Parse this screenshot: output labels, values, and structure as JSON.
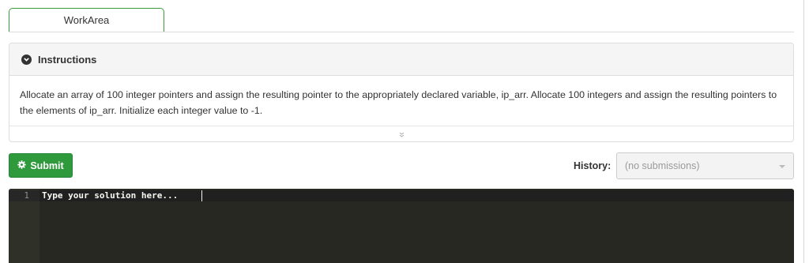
{
  "tabs": {
    "active_label": "WorkArea"
  },
  "instructions": {
    "title": "Instructions",
    "text": "Allocate an array of 100 integer pointers and assign the resulting pointer to the appropriately declared variable, ip_arr. Allocate 100 integers and assign the resulting pointers to the elements of ip_arr. Initialize each integer value to -1.",
    "icons": {
      "header": "chevron-circle-down-icon",
      "footer": "double-chevron-down-icon"
    }
  },
  "toolbar": {
    "submit_label": "Submit",
    "submit_icon": "gear-icon"
  },
  "history": {
    "label": "History:",
    "selected": "(no submissions)"
  },
  "editor": {
    "line_number": "1",
    "placeholder": "Type your solution here..."
  },
  "colors": {
    "accent": "#2e9a3c",
    "tab_border": "#3a9d3a",
    "editor_bg": "#272822",
    "gutter_bg": "#2f3129"
  }
}
